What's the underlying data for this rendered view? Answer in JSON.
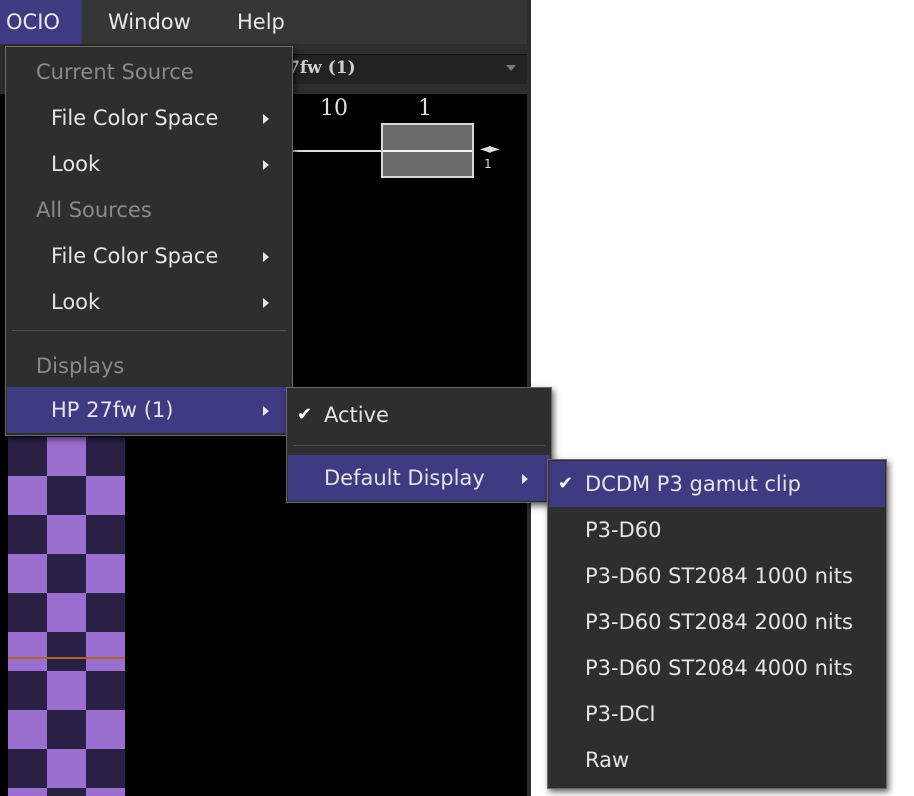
{
  "menubar": {
    "items": [
      "OCIO",
      "Window",
      "Help"
    ]
  },
  "toolbar": {
    "combo_text": "7fw (1)"
  },
  "viewer": {
    "ruler_left": "10",
    "ruler_right": "1",
    "mini_arrows": "◄►",
    "mini_number": "1"
  },
  "ocio_menu": {
    "current_source_header": "Current Source",
    "current_file_color_space": "File Color Space",
    "current_look": "Look",
    "all_sources_header": "All Sources",
    "all_file_color_space": "File Color Space",
    "all_look": "Look",
    "displays_header": "Displays",
    "display_item": "HP 27fw (1)"
  },
  "display_submenu": {
    "active_label": "Active",
    "default_display_label": "Default Display"
  },
  "view_submenu": {
    "items": [
      "DCDM P3 gamut clip",
      "P3-D60",
      "P3-D60 ST2084 1000 nits",
      "P3-D60 ST2084 2000 nits",
      "P3-D60 ST2084 4000 nits",
      "P3-DCI",
      "Raw"
    ],
    "checkmark": "✔"
  },
  "colors": {
    "highlight": "#3f3b83",
    "menu_bg": "#2e2e2e",
    "checker_light": "#9b6fd0",
    "checker_dark": "#2a1f45"
  }
}
